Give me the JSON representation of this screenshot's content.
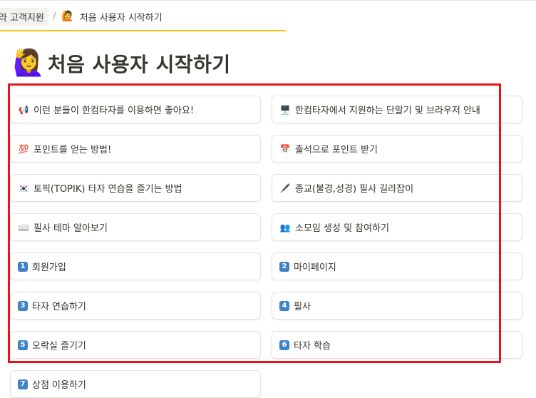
{
  "breadcrumb": {
    "parent": "라 고객지원",
    "separator": "/",
    "current": "처음 사용자 시작하기"
  },
  "page": {
    "title": "처음 사용자 시작하기"
  },
  "links": [
    {
      "icon": "📢",
      "label": "이런 분들이 한컴타자를 이용하면 좋아요!"
    },
    {
      "icon": "🖥️",
      "label": "한컴타자에서 지원하는 단말기 및 브라우저 안내"
    },
    {
      "icon": "💯",
      "label": "포인트를 얻는 방법!"
    },
    {
      "icon": "📅",
      "label": "출석으로 포인트 받기"
    },
    {
      "icon": "🇰🇷",
      "label": "토픽(TOPIK) 타자 연습을 즐기는 방법"
    },
    {
      "icon": "🖋️",
      "label": "종교(불경,성경) 필사 길라잡이"
    },
    {
      "icon": "📖",
      "label": "필사 테마 알아보기"
    },
    {
      "icon": "👥",
      "label": "소모임 생성 및 참여하기"
    },
    {
      "num": "1",
      "label": "회원가입"
    },
    {
      "num": "2",
      "label": "마이페이지"
    },
    {
      "num": "3",
      "label": "타자 연습하기"
    },
    {
      "num": "4",
      "label": "필사"
    },
    {
      "num": "5",
      "label": "오락실 즐기기"
    },
    {
      "num": "6",
      "label": "타자 학습"
    },
    {
      "num": "7",
      "label": "상점 이용하기"
    }
  ],
  "colors": {
    "accent_underline": "#f5c518",
    "highlight_box": "#e8141a",
    "number_badge": "#3e83c8"
  }
}
